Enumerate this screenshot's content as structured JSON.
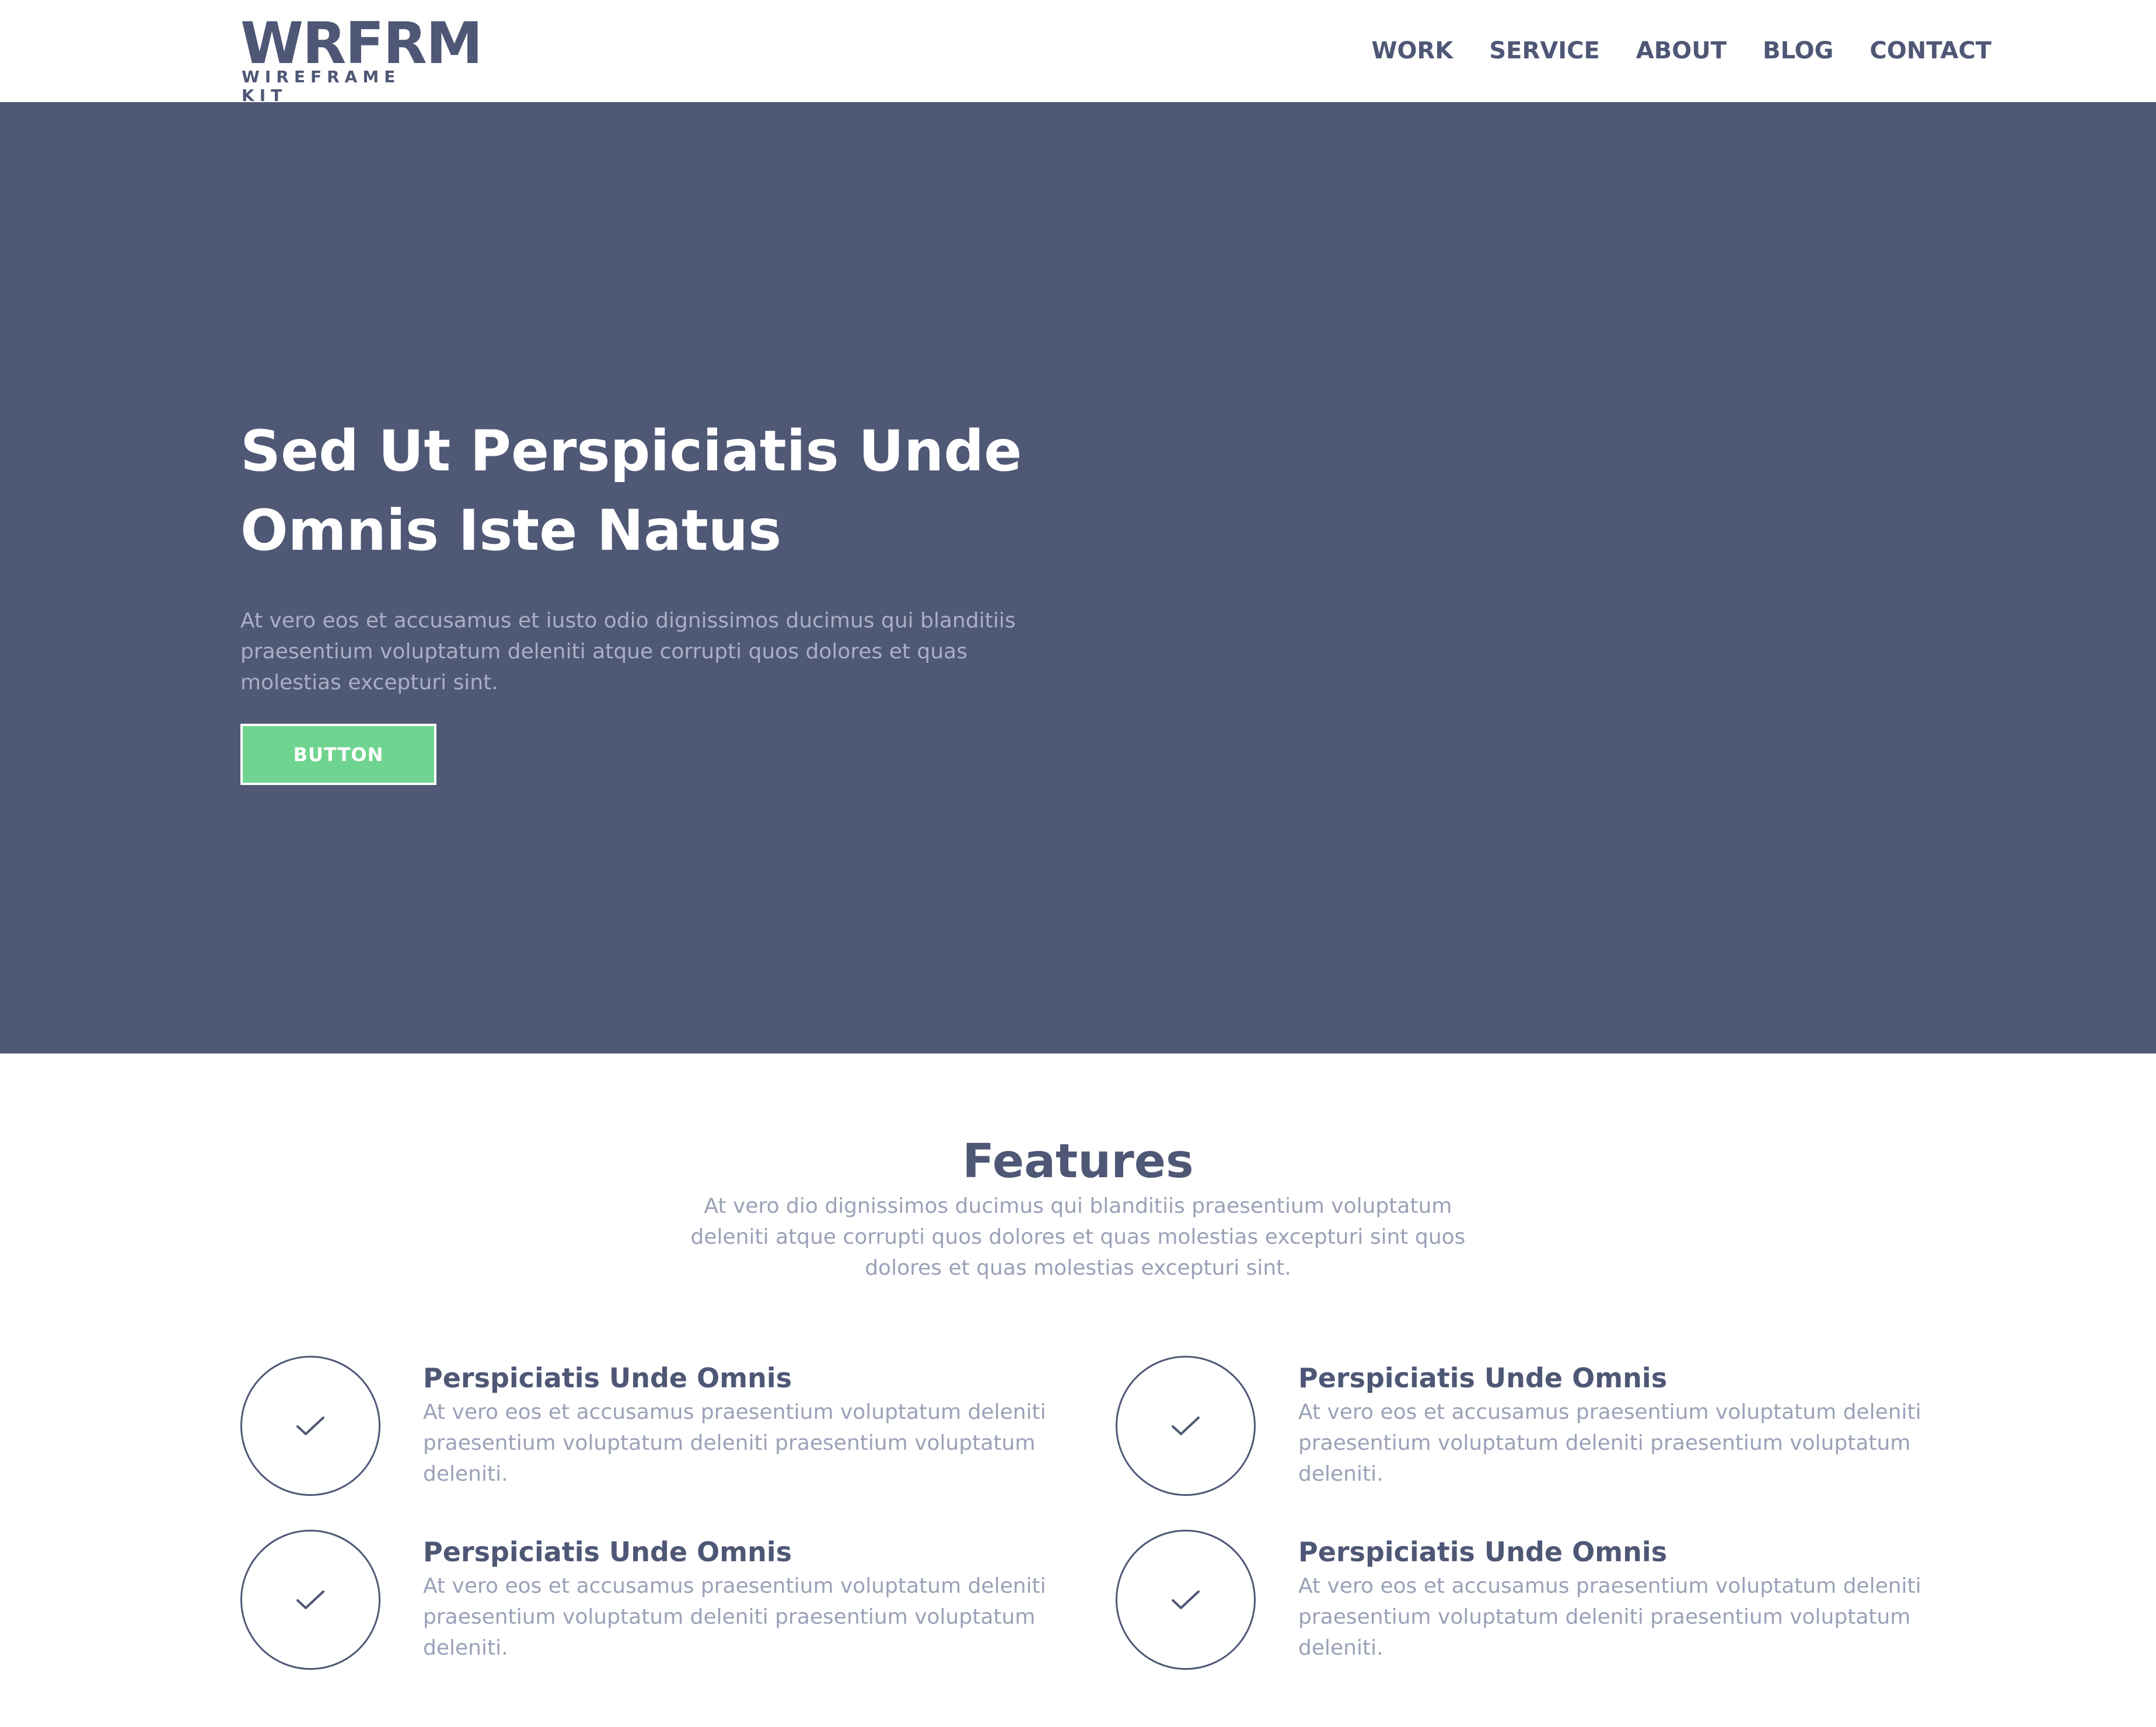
{
  "brand": {
    "logo_word": "WRFRM",
    "logo_sub": "WIREFRAME KIT"
  },
  "nav": {
    "items": [
      "WORK",
      "SERVICE",
      "ABOUT",
      "BLOG",
      "CONTACT"
    ]
  },
  "hero": {
    "title": "Sed Ut Perspiciatis Unde Omnis Iste Natus",
    "text": "At vero eos et accusamus et iusto odio dignissimos ducimus qui blanditiis praesentium voluptatum deleniti atque corrupti quos dolores et quas molestias excepturi sint.",
    "button_label": "BUTTON"
  },
  "features": {
    "title": "Features",
    "text": "At vero dio dignissimos ducimus qui blanditiis praesentium voluptatum deleniti atque corrupti quos dolores et quas molestias excepturi sint quos dolores et quas molestias excepturi sint.",
    "items": [
      {
        "icon": "check-icon",
        "title": "Perspiciatis Unde Omnis",
        "text": "At vero eos et accusamus praesentium voluptatum deleniti praesentium voluptatum deleniti praesentium voluptatum deleniti."
      },
      {
        "icon": "check-icon",
        "title": "Perspiciatis Unde Omnis",
        "text": "At vero eos et accusamus praesentium voluptatum deleniti praesentium voluptatum deleniti praesentium voluptatum deleniti."
      },
      {
        "icon": "check-icon",
        "title": "Perspiciatis Unde Omnis",
        "text": "At vero eos et accusamus praesentium voluptatum deleniti praesentium voluptatum deleniti praesentium voluptatum deleniti."
      },
      {
        "icon": "check-icon",
        "title": "Perspiciatis Unde Omnis",
        "text": "At vero eos et accusamus praesentium voluptatum deleniti praesentium voluptatum deleniti praesentium voluptatum deleniti."
      }
    ]
  },
  "colors": {
    "primary": "#4f5875",
    "accent": "#6fd48f",
    "muted_text": "#9aa1b7",
    "background": "#ffffff"
  }
}
